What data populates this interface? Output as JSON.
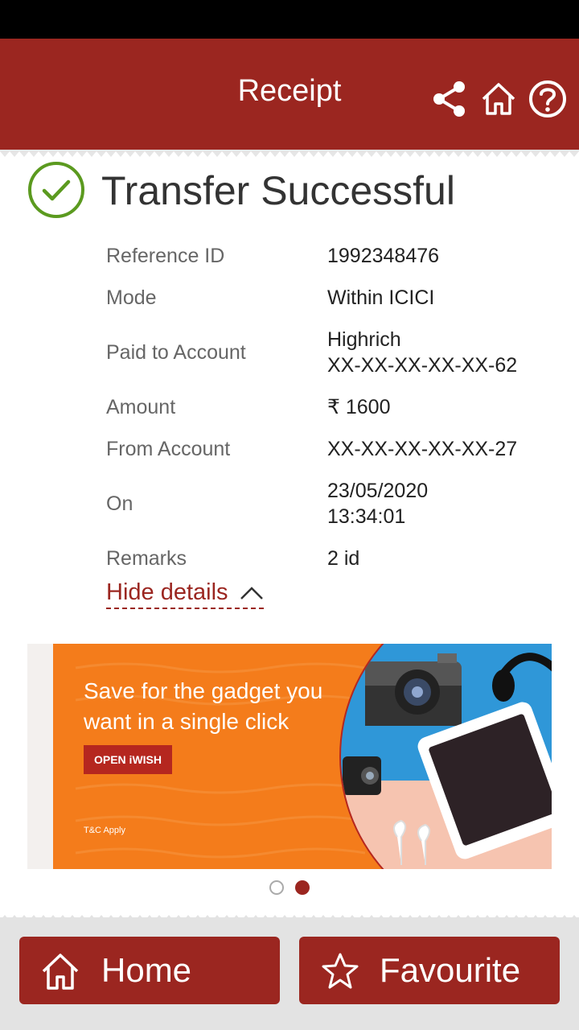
{
  "header": {
    "title": "Receipt",
    "icons": [
      "share-icon",
      "home-icon",
      "help-icon"
    ],
    "bg_color": "#9b2620"
  },
  "status": {
    "title": "Transfer Successful",
    "icon": "check-circle-icon",
    "icon_color": "#5b9a1f"
  },
  "details": [
    {
      "label": "Reference ID",
      "value": "1992348476"
    },
    {
      "label": "Mode",
      "value": "Within ICICI"
    },
    {
      "label": "Paid to Account",
      "value": "Highrich",
      "value2": "XX-XX-XX-XX-XX-62"
    },
    {
      "label": "Amount",
      "value": "₹ 1600"
    },
    {
      "label": "From Account",
      "value": "XX-XX-XX-XX-XX-27"
    },
    {
      "label": "On",
      "value": "23/05/2020",
      "value2": "13:34:01"
    },
    {
      "label": "Remarks",
      "value": "2 id"
    }
  ],
  "hide_details": "Hide details",
  "banner": {
    "headline_line1": "Save for the gadget you",
    "headline_line2": "want in a single click",
    "button": "OPEN iWISH",
    "terms": "T&C Apply",
    "bg_color": "#f47c1b"
  },
  "carousel": {
    "count": 2,
    "active": 2
  },
  "footer": {
    "home_label": "Home",
    "favourite_label": "Favourite"
  }
}
